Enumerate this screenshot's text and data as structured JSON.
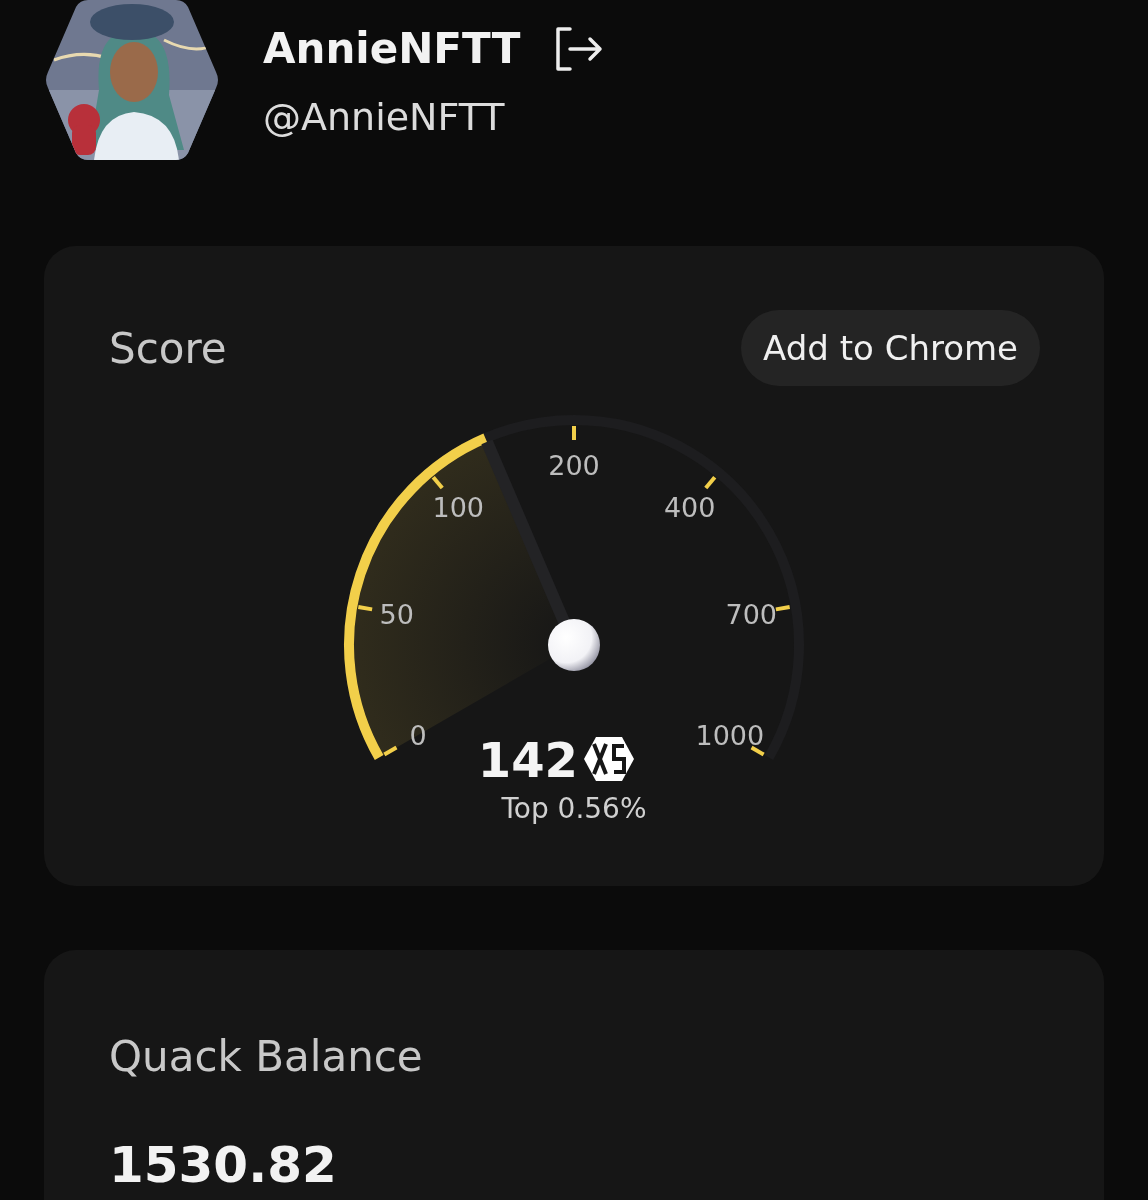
{
  "profile": {
    "name": "AnnieNFTT",
    "handle": "@AnnieNFTT"
  },
  "score_card": {
    "title": "Score",
    "button": "Add to Chrome",
    "gauge": {
      "value": "142",
      "rank": "Top 0.56%",
      "ticks": [
        "0",
        "50",
        "100",
        "200",
        "400",
        "700",
        "1000"
      ]
    }
  },
  "balance_card": {
    "title": "Quack Balance",
    "value": "1530.82"
  }
}
